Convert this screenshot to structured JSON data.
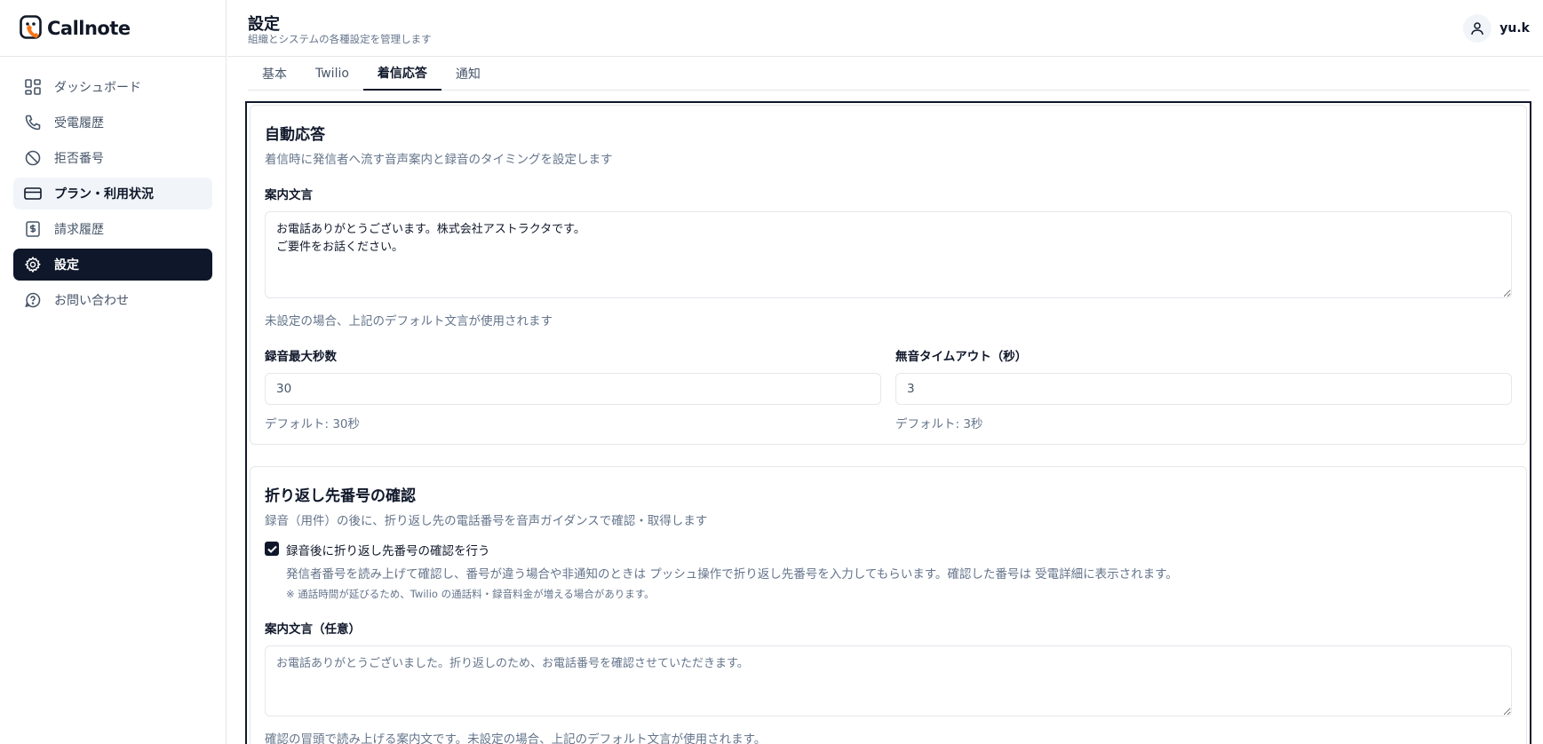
{
  "app": {
    "name": "Callnote"
  },
  "sidebar": {
    "items": [
      {
        "label": "ダッシュボード",
        "icon": "dashboard-icon"
      },
      {
        "label": "受電履歴",
        "icon": "phone-icon"
      },
      {
        "label": "拒否番号",
        "icon": "ban-icon"
      },
      {
        "label": "プラン・利用状況",
        "icon": "credit-card-icon"
      },
      {
        "label": "請求履歴",
        "icon": "receipt-icon"
      },
      {
        "label": "設定",
        "icon": "gear-icon"
      },
      {
        "label": "お問い合わせ",
        "icon": "help-icon"
      }
    ]
  },
  "header": {
    "title": "設定",
    "subtitle": "組織とシステムの各種設定を管理します",
    "username": "yu.k"
  },
  "tabs": [
    {
      "label": "基本"
    },
    {
      "label": "Twilio"
    },
    {
      "label": "着信応答"
    },
    {
      "label": "通知"
    }
  ],
  "auto_answer": {
    "title": "自動応答",
    "description": "着信時に発信者へ流す音声案内と録音のタイミングを設定します",
    "message_label": "案内文言",
    "message_value": "お電話ありがとうございます。株式会社アストラクタです。\nご要件をお話ください。",
    "message_help": "未設定の場合、上記のデフォルト文言が使用されます",
    "max_record_label": "録音最大秒数",
    "max_record_value": "30",
    "max_record_help": "デフォルト: 30秒",
    "silence_label": "無音タイムアウト（秒）",
    "silence_value": "3",
    "silence_help": "デフォルト: 3秒"
  },
  "callback": {
    "title": "折り返し先番号の確認",
    "description": "録音（用件）の後に、折り返し先の電話番号を音声ガイダンスで確認・取得します",
    "checkbox_label": "録音後に折り返し先番号の確認を行う",
    "checkbox_checked": true,
    "checkbox_desc": "発信者番号を読み上げて確認し、番号が違う場合や非通知のときは プッシュ操作で折り返し先番号を入力してもらいます。確認した番号は 受電詳細に表示されます。",
    "checkbox_note": "※ 通話時間が延びるため、Twilio の通話料・録音料金が増える場合があります。",
    "message_label": "案内文言（任意）",
    "message_placeholder": "お電話ありがとうございました。折り返しのため、お電話番号を確認させていただきます。",
    "message_help": "確認の冒頭で読み上げる案内文です。未設定の場合、上記のデフォルト文言が使用されます。"
  }
}
